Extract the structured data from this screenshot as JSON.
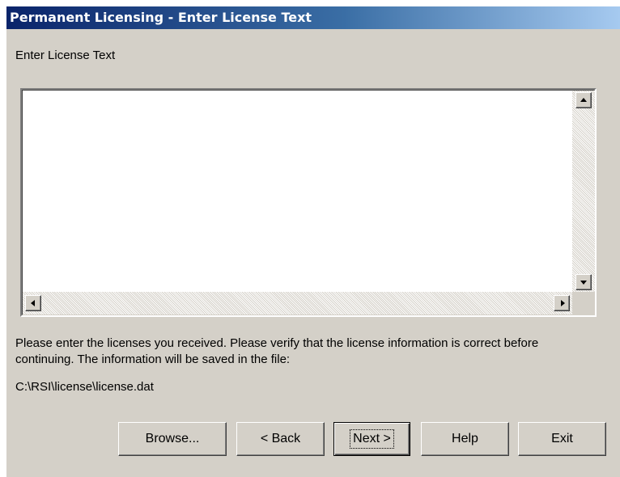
{
  "window": {
    "title": "Permanent Licensing - Enter License Text"
  },
  "content": {
    "heading": "Enter License Text",
    "license_text": "",
    "info_text": "Please enter the licenses you received.  Please verify that the license information is correct before continuing.  The information will be saved in the file:",
    "file_path": "C:\\RSI\\license\\license.dat"
  },
  "buttons": {
    "browse": "Browse...",
    "back": "< Back",
    "next": "Next >",
    "help": "Help",
    "exit": "Exit"
  },
  "icons": {
    "scroll_up": "scroll-up-arrow",
    "scroll_down": "scroll-down-arrow",
    "scroll_left": "scroll-left-arrow",
    "scroll_right": "scroll-right-arrow"
  },
  "colors": {
    "title_gradient_start": "#0a246a",
    "title_gradient_end": "#a6caf0",
    "dialog_face": "#d4d0c8"
  }
}
